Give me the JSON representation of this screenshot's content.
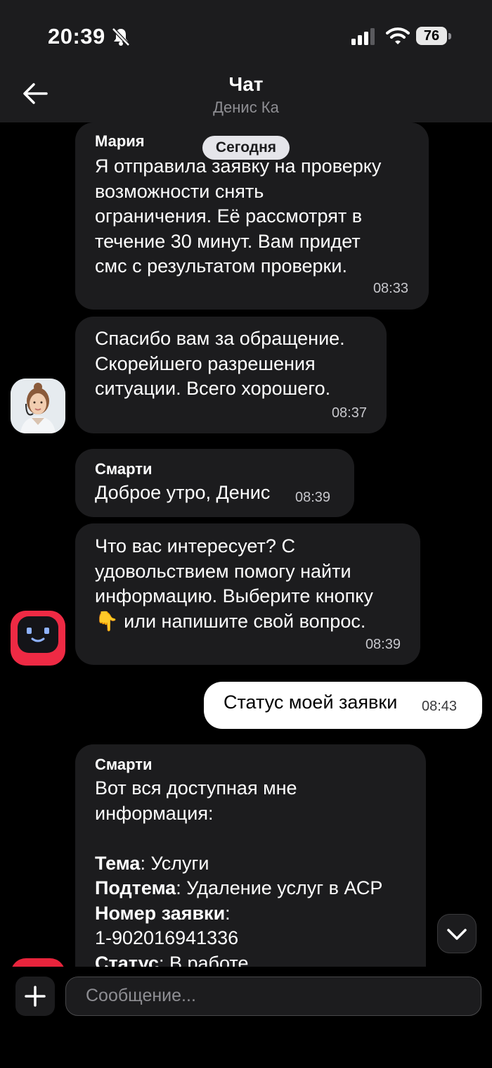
{
  "status_bar": {
    "time": "20:39",
    "battery": "76",
    "icons": [
      "bell-slash-icon",
      "cellular-signal-icon",
      "wifi-icon",
      "battery-icon"
    ]
  },
  "header": {
    "title": "Чат",
    "subtitle": "Денис Ка",
    "back_icon": "arrow-left-icon"
  },
  "date_separator": "Сегодня",
  "messages": [
    {
      "sender": "Мария",
      "lines": [
        "Я отправила заявку на проверку",
        "возможности снять",
        "ограничения. Её рассмотрят в",
        "течение 30 минут. Вам придет",
        "смс с результатом проверки."
      ],
      "time": "08:33"
    },
    {
      "lines": [
        "Спасибо вам за обращение.",
        "Скорейшего разрешения",
        "ситуации. Всего хорошего."
      ],
      "time": "08:37",
      "avatar": "operator-avatar"
    },
    {
      "sender": "Смарти",
      "lines": [
        "Доброе утро, Денис"
      ],
      "time": "08:39"
    },
    {
      "lines": [
        "Что вас интересует? С",
        "удовольствием помогу найти",
        "информацию. Выберите кнопку",
        "👇 или напишите свой вопрос."
      ],
      "time": "08:39",
      "avatar": "bot-avatar"
    },
    {
      "outgoing": true,
      "text": "Статус моей заявки",
      "time": "08:43"
    },
    {
      "sender": "Смарти",
      "intro": [
        "Вот вся доступная мне",
        "информация:"
      ],
      "fields": {
        "topic_label": "Тема",
        "topic_value": ": Услуги",
        "subtopic_label": "Подтема",
        "subtopic_value": ": Удаление услуг в АСР",
        "number_label": "Номер заявки",
        "number_value": ":",
        "number": "1-902016941336",
        "status_label": "Статус",
        "status_value": ": В работе"
      }
    }
  ],
  "scroll_down_icon": "chevron-down-icon",
  "composer": {
    "placeholder": "Сообщение...",
    "attach_icon": "plus-icon"
  }
}
